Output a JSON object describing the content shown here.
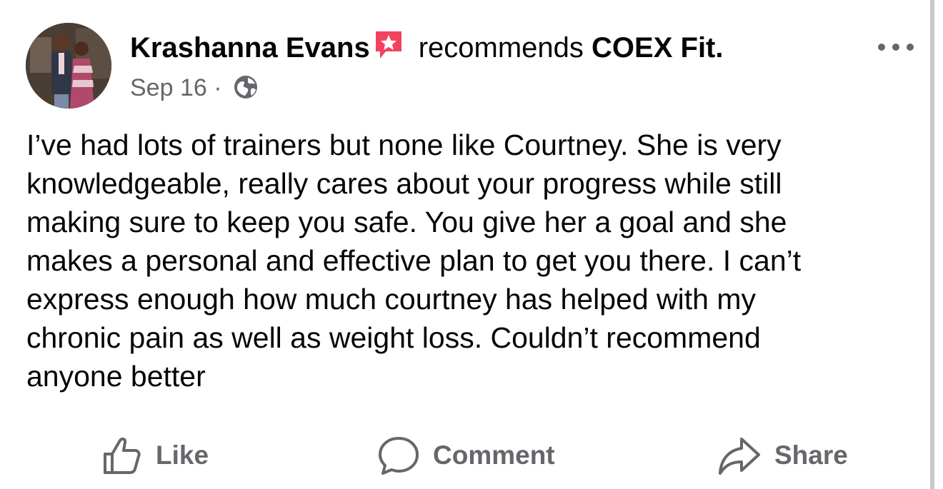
{
  "post": {
    "author": "Krashanna Evans",
    "action_text": "recommends",
    "page_name": "COEX Fit.",
    "date": "Sep 16",
    "separator": "·",
    "body": "I’ve had lots of trainers but none like Courtney. She is very\nknowledgeable, really cares about your progress while still\nmaking sure to keep you safe. You give her a goal and she\nmakes a personal and effective plan to get you there. I can’t\nexpress enough how much courtney has helped with my\nchronic pain as well as weight loss. Couldn’t recommend\nanyone better"
  },
  "actions": {
    "like": "Like",
    "comment": "Comment",
    "share": "Share"
  },
  "icons": {
    "badge": "recommendation-star-icon",
    "audience": "globe-icon",
    "more": "more-options-icon",
    "like": "thumbs-up-icon",
    "comment": "comment-bubble-icon",
    "share": "share-arrow-icon"
  },
  "colors": {
    "badge": "#f3425f",
    "secondary_text": "#65676b",
    "primary_text": "#050505"
  }
}
